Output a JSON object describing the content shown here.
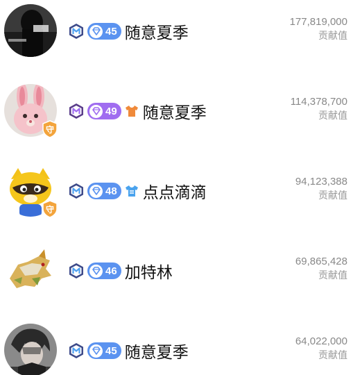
{
  "contributors": [
    {
      "name": "随意夏季",
      "level": "45",
      "level_color": "#5b93f0",
      "has_shirt": false,
      "has_guard": false,
      "score": "177,819,000",
      "score_label": "贡献值",
      "avatar": "dark-figure-avatar"
    },
    {
      "name": "随意夏季",
      "level": "49",
      "level_color": "#a06df0",
      "has_shirt": true,
      "shirt_color": "#f08a3a",
      "has_guard": true,
      "guard_label": "守",
      "score": "114,378,700",
      "score_label": "贡献值",
      "avatar": "pink-bunny-avatar"
    },
    {
      "name": "点点滴滴",
      "level": "48",
      "level_color": "#5b93f0",
      "has_shirt": true,
      "shirt_color": "#4aa3ee",
      "has_guard": true,
      "guard_label": "守",
      "score": "94,123,388",
      "score_label": "贡献值",
      "avatar": "raccoon-mascot-avatar"
    },
    {
      "name": "加特林",
      "level": "46",
      "level_color": "#5b93f0",
      "has_shirt": false,
      "has_guard": false,
      "score": "69,865,428",
      "score_label": "贡献值",
      "avatar": "armored-beast-avatar"
    },
    {
      "name": "随意夏季",
      "level": "45",
      "level_color": "#5b93f0",
      "has_shirt": false,
      "has_guard": false,
      "score": "64,022,000",
      "score_label": "贡献值",
      "avatar": "anime-boy-avatar"
    }
  ]
}
